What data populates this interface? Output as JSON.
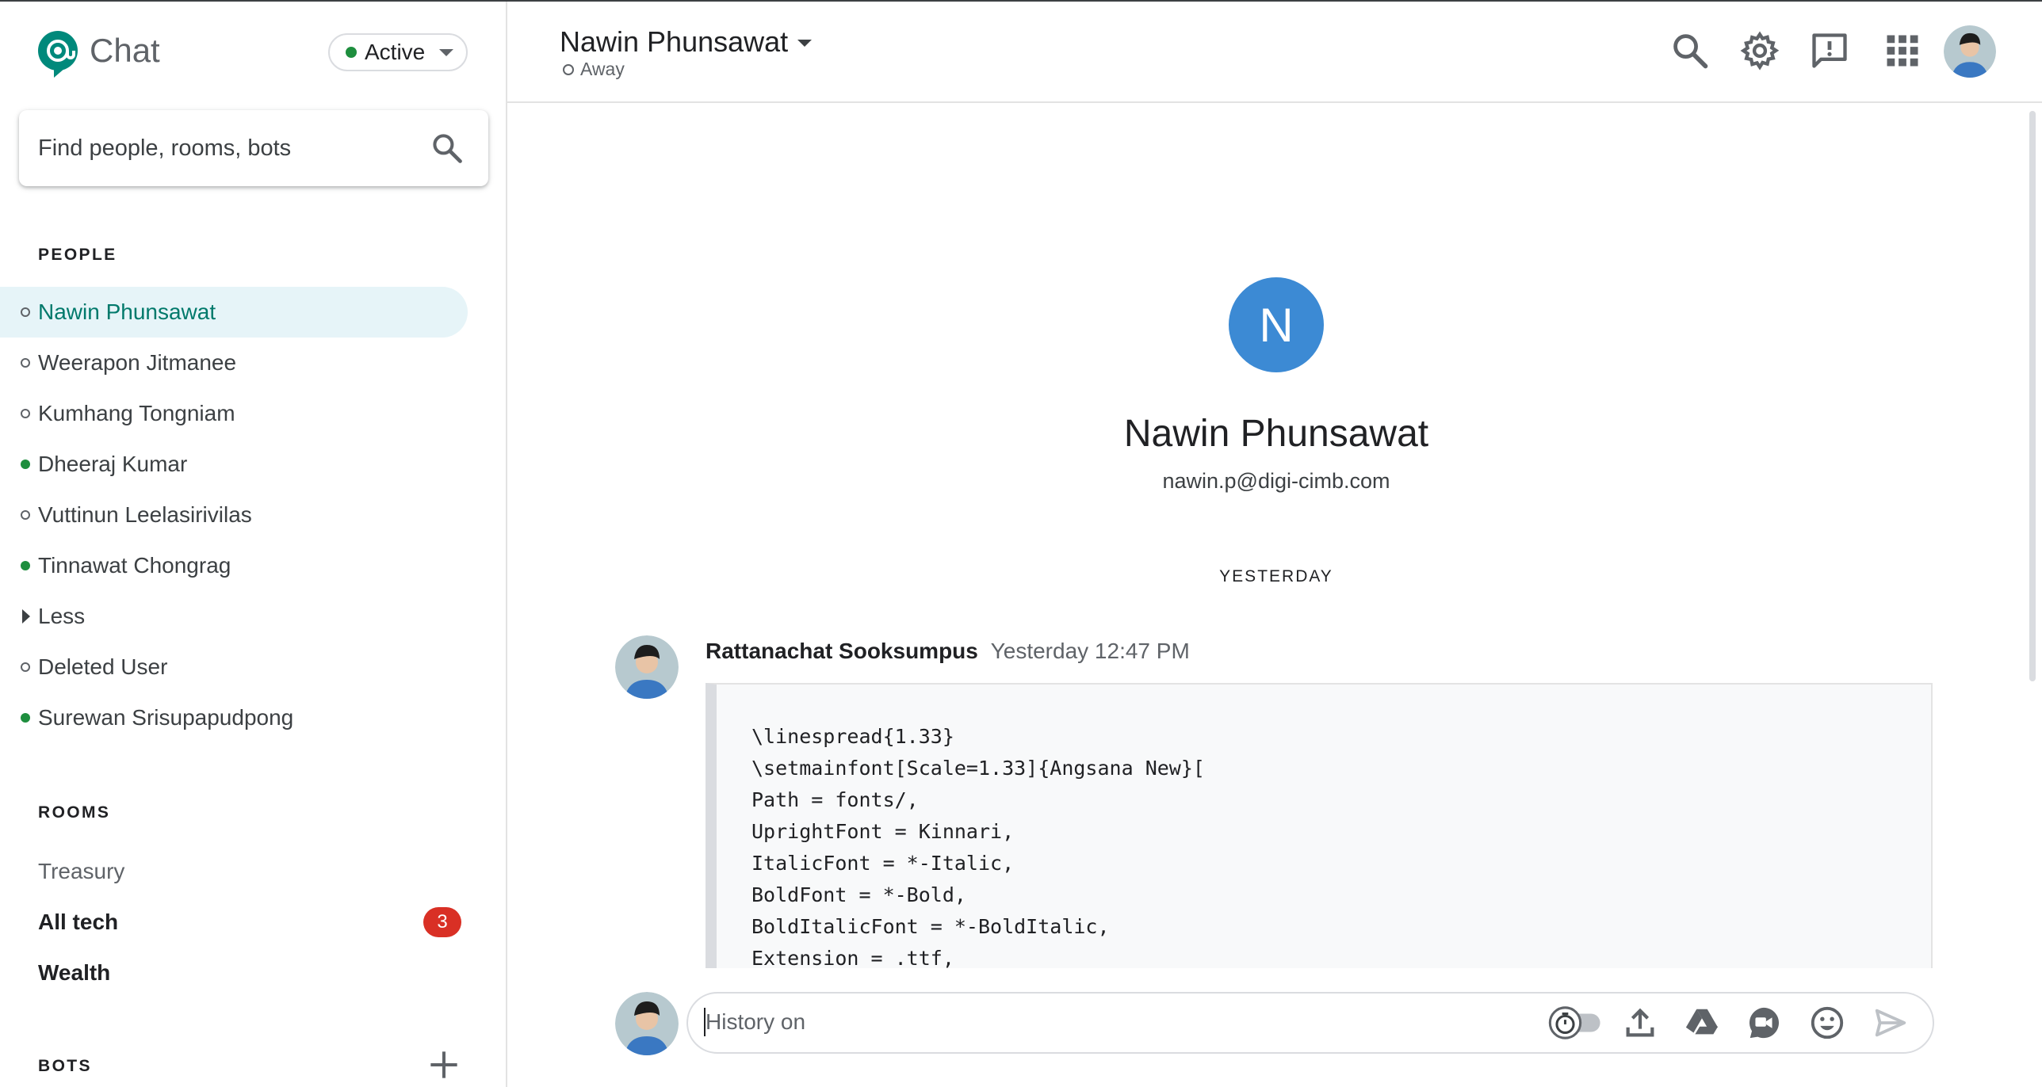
{
  "app": {
    "name": "Chat",
    "status": "Active"
  },
  "search": {
    "placeholder": "Find people, rooms, bots"
  },
  "sections": {
    "people": "PEOPLE",
    "rooms": "ROOMS",
    "bots": "BOTS"
  },
  "people": [
    {
      "name": "Nawin Phunsawat",
      "presence": "away",
      "selected": true
    },
    {
      "name": "Weerapon Jitmanee",
      "presence": "away"
    },
    {
      "name": "Kumhang Tongniam",
      "presence": "away"
    },
    {
      "name": "Dheeraj Kumar",
      "presence": "active"
    },
    {
      "name": "Vuttinun Leelasirivilas",
      "presence": "away"
    },
    {
      "name": "Tinnawat Chongrag",
      "presence": "active"
    },
    {
      "name": "Less",
      "presence": "toggle"
    },
    {
      "name": "Deleted User",
      "presence": "away"
    },
    {
      "name": "Surewan Srisupapudpong",
      "presence": "active"
    }
  ],
  "rooms": [
    {
      "name": "Treasury",
      "unread": false
    },
    {
      "name": "All tech",
      "unread": true,
      "badge": "3"
    },
    {
      "name": "Wealth",
      "unread": true
    }
  ],
  "header": {
    "name": "Nawin Phunsawat",
    "status": "Away"
  },
  "profile": {
    "initial": "N",
    "name": "Nawin Phunsawat",
    "email": "nawin.p@digi-cimb.com"
  },
  "day_separator": "YESTERDAY",
  "message": {
    "sender": "Rattanachat Sooksumpus",
    "time": "Yesterday 12:47 PM",
    "code": [
      "\\linespread{1.33}",
      "\\setmainfont[Scale=1.33]{Angsana New}[",
      "Path = fonts/,",
      "UprightFont = Kinnari,",
      "ItalicFont = *-Italic,",
      "BoldFont = *-Bold,",
      "BoldItalicFont = *-BoldItalic,",
      "Extension = .ttf,"
    ]
  },
  "composer": {
    "placeholder": "History on"
  },
  "icons": {
    "header": [
      "search-icon",
      "gear-icon",
      "feedback-icon",
      "apps-grid-icon"
    ],
    "composer": [
      "history-toggle-icon",
      "upload-icon",
      "drive-icon",
      "video-meet-icon",
      "emoji-icon",
      "send-icon"
    ]
  },
  "colors": {
    "accent_green": "#1e8e3e",
    "selected_bg": "#e6f4f8",
    "badge_red": "#d93025",
    "avatar_blue": "#3c8ad4"
  }
}
